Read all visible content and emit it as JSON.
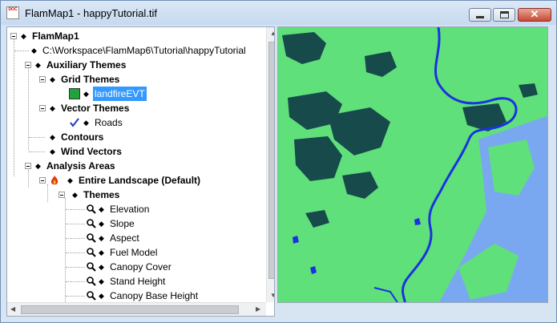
{
  "window": {
    "title": "FlamMap1 - happyTutorial.tif",
    "app_icon_text": "DOC",
    "close_glyph": "✕"
  },
  "tree": {
    "items": [
      {
        "label": "FlamMap1",
        "bold": true
      },
      {
        "label": "C:\\Workspace\\FlamMap6\\Tutorial\\happyTutorial"
      },
      {
        "label": "Auxiliary Themes",
        "bold": true
      },
      {
        "label": "Grid Themes",
        "bold": true
      },
      {
        "label": "landfireEVT",
        "selected": true,
        "icon": "grid-theme-icon"
      },
      {
        "label": "Vector Themes",
        "bold": true
      },
      {
        "label": "Roads",
        "icon": "checkmark-icon"
      },
      {
        "label": "Contours",
        "bold": true
      },
      {
        "label": "Wind Vectors",
        "bold": true
      },
      {
        "label": "Analysis Areas",
        "bold": true
      },
      {
        "label": "Entire Landscape (Default)",
        "bold": true,
        "icon": "fire-icon"
      },
      {
        "label": "Themes",
        "bold": true
      },
      {
        "label": "Elevation",
        "icon": "magnifier-icon"
      },
      {
        "label": "Slope",
        "icon": "magnifier-icon"
      },
      {
        "label": "Aspect",
        "icon": "magnifier-icon"
      },
      {
        "label": "Fuel Model",
        "icon": "magnifier-icon"
      },
      {
        "label": "Canopy Cover",
        "icon": "magnifier-icon"
      },
      {
        "label": "Stand Height",
        "icon": "magnifier-icon"
      },
      {
        "label": "Canopy Base Height",
        "icon": "magnifier-icon"
      }
    ]
  },
  "map": {
    "colors": {
      "land": "#5fe07a",
      "forest": "#174a4a",
      "water": "#1b32e0",
      "shallow": "#7aa8f0"
    }
  }
}
